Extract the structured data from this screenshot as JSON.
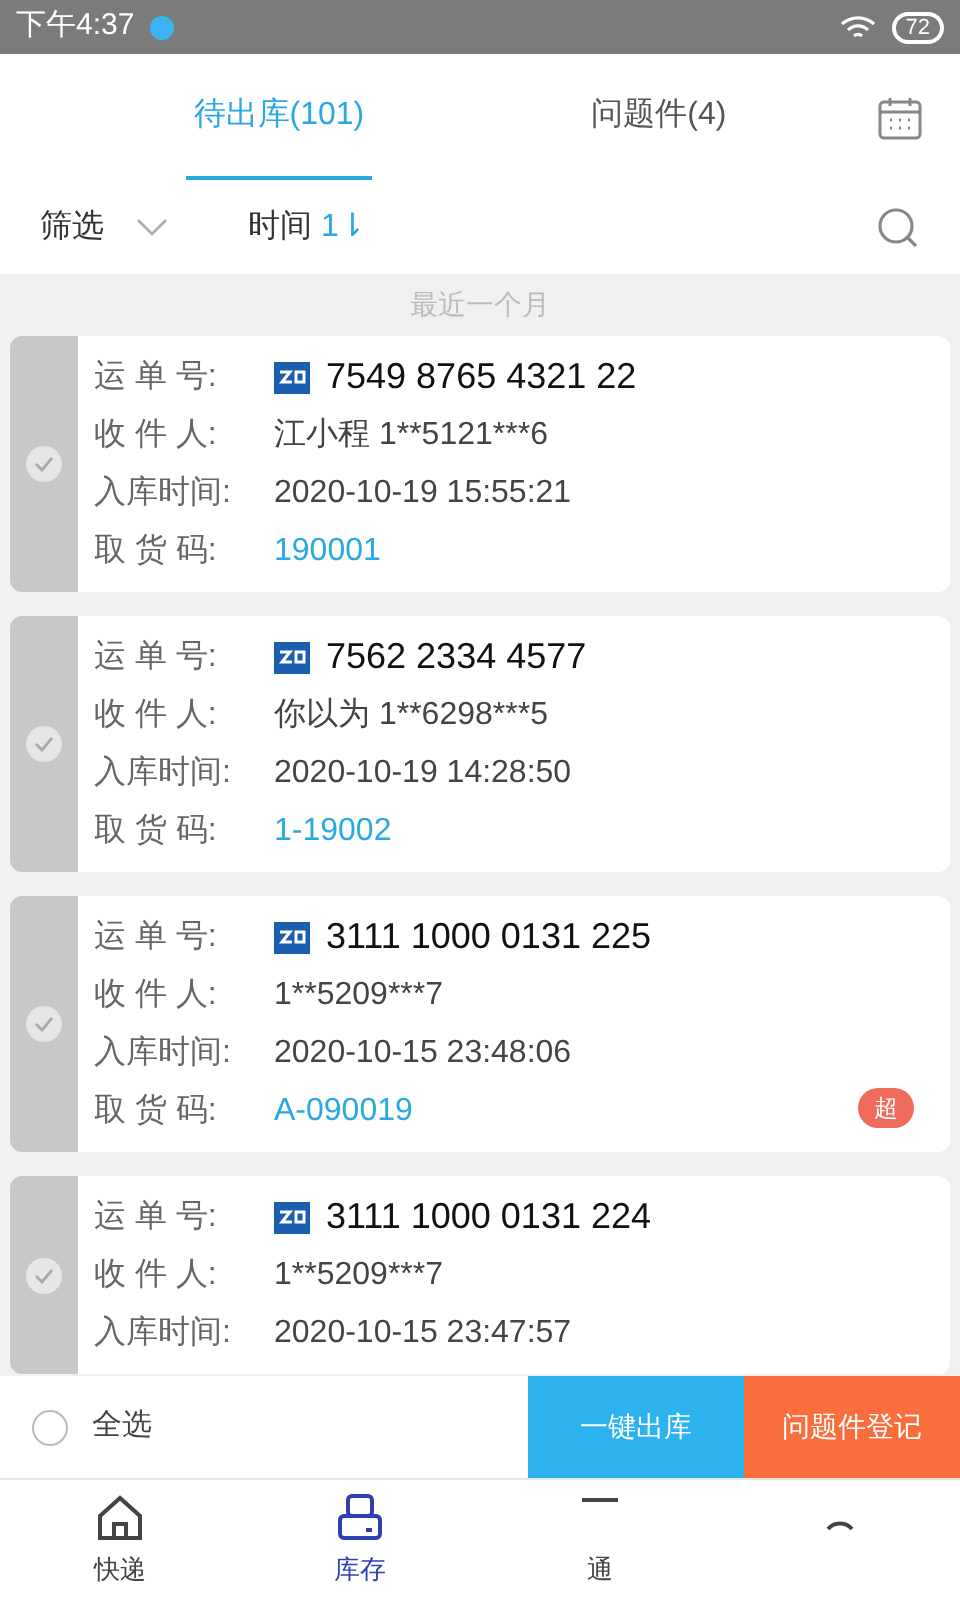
{
  "status_bar": {
    "time": "下午4:37",
    "battery": "72"
  },
  "tabs": [
    {
      "label": "待出库(101)",
      "selected": true
    },
    {
      "label": "问题件(4)",
      "selected": false
    }
  ],
  "filter_bar": {
    "filter": "筛选",
    "sort": "时间",
    "sort_icon": "1⇂"
  },
  "section_header": "最近一个月",
  "cards": [
    {
      "selected": false,
      "rows": [
        {
          "kind": "tracking",
          "label": "运 单 号:",
          "value": "7549 8765 4321 22"
        },
        {
          "kind": "text",
          "label": "收 件 人:",
          "value": "江小程 1**5121***6"
        },
        {
          "kind": "text",
          "label": "入库时间:",
          "value": "2020-10-19 15:55:21"
        },
        {
          "kind": "code",
          "label": "取 货 码:",
          "value": "190001"
        }
      ]
    },
    {
      "selected": false,
      "rows": [
        {
          "kind": "tracking",
          "label": "运 单 号:",
          "value": "7562 2334 4577"
        },
        {
          "kind": "text",
          "label": "收 件 人:",
          "value": "你以为 1**6298***5"
        },
        {
          "kind": "text",
          "label": "入库时间:",
          "value": "2020-10-19 14:28:50"
        },
        {
          "kind": "code",
          "label": "取 货 码:",
          "value": "1-19002"
        }
      ]
    },
    {
      "selected": false,
      "badge": "超",
      "rows": [
        {
          "kind": "tracking",
          "label": "运 单 号:",
          "value": "3111 1000 0131 225"
        },
        {
          "kind": "text",
          "label": "收 件 人:",
          "value": "1**5209***7"
        },
        {
          "kind": "text",
          "label": "入库时间:",
          "value": "2020-10-15 23:48:06"
        },
        {
          "kind": "code",
          "label": "取 货 码:",
          "value": "A-090019"
        }
      ]
    },
    {
      "selected": false,
      "rows": [
        {
          "kind": "tracking",
          "label": "运 单 号:",
          "value": "3111 1000 0131 224"
        },
        {
          "kind": "text",
          "label": "收 件 人:",
          "value": "1**5209***7"
        },
        {
          "kind": "text",
          "label": "入库时间:",
          "value": "2020-10-15 23:47:57"
        }
      ]
    }
  ],
  "action_bar": {
    "select_all": {
      "label": "全选",
      "selected": false
    },
    "buttons": [
      {
        "label": "一键出库",
        "kind": "primary"
      },
      {
        "label": "问题件登记",
        "kind": "warning"
      }
    ]
  },
  "bottom_nav": [
    {
      "label": "快递",
      "kind": "home",
      "selected": false
    },
    {
      "label": "库存",
      "kind": "box",
      "selected": true
    },
    {
      "label": "通",
      "kind": "list",
      "selected": false
    },
    {
      "kind": "user",
      "selected": false
    }
  ]
}
